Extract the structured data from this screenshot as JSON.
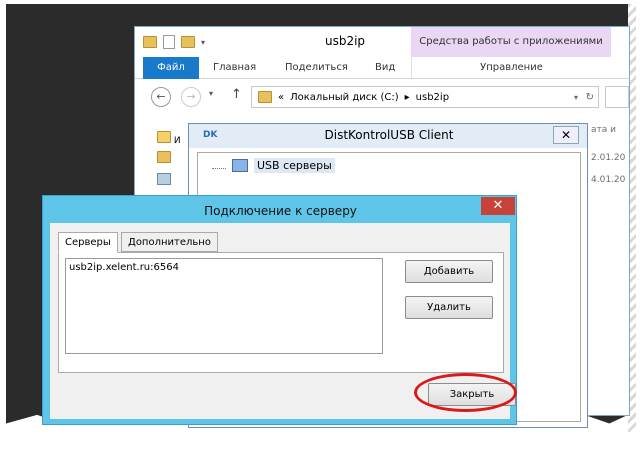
{
  "explorer": {
    "title": "usb2ip",
    "tools_tab": "Средства работы с приложениями",
    "ribbon_tabs": {
      "file": "Файл",
      "home": "Главная",
      "share": "Поделиться",
      "view": "Вид",
      "manage": "Управление"
    },
    "address": {
      "prefix": "«",
      "drive": "Локальный диск (C:)",
      "folder": "usb2ip"
    },
    "column_header_partial": "ата и",
    "dates": [
      "2.01.20",
      "4.01.20"
    ],
    "tree_partial": "И"
  },
  "distkontrol": {
    "logo": "DK",
    "title": "DistKontrolUSB Client",
    "close_glyph": "✕",
    "tree_node": "USB серверы"
  },
  "dialog": {
    "title": "Подключение к серверу",
    "close_glyph": "✕",
    "tabs": [
      "Серверы",
      "Дополнительно"
    ],
    "servers": [
      "usb2ip.xelent.ru:6564"
    ],
    "add_button": "Добавить",
    "remove_button": "Удалить",
    "close_button": "Закрыть"
  },
  "colors": {
    "dialog_frame": "#5ec4e8",
    "close_red": "#c7433a",
    "highlight_red": "#d91a1a",
    "file_tab_blue": "#1979ca"
  }
}
